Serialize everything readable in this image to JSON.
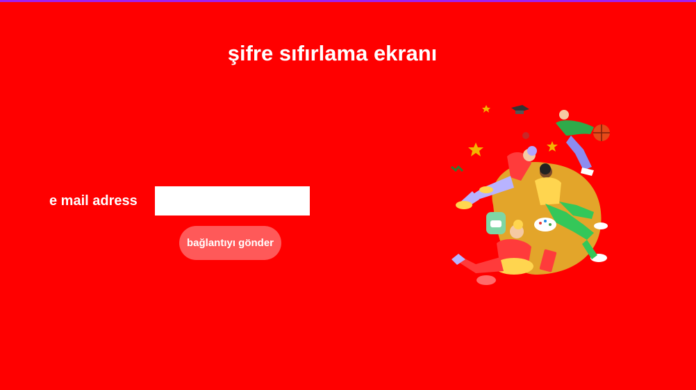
{
  "page": {
    "title": "şifre sıfırlama ekranı",
    "background_color": "#ff0000",
    "top_strip_color": "#a020f0"
  },
  "form": {
    "email_label": "e mail adress",
    "email_value": "",
    "email_placeholder": "",
    "submit_label": "bağlantıyı gönder"
  },
  "illustration": {
    "icon": "students-illustration-icon"
  }
}
